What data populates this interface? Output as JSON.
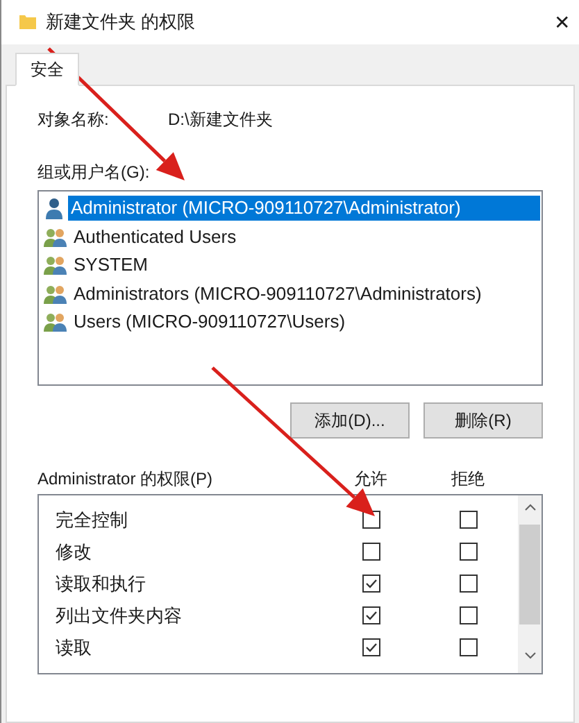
{
  "window": {
    "title": "新建文件夹 的权限",
    "close": "✕"
  },
  "tabs": [
    {
      "label": "安全",
      "selected": true
    }
  ],
  "object_name": {
    "label": "对象名称:",
    "value": "D:\\新建文件夹"
  },
  "users": {
    "label": "组或用户名(G):",
    "items": [
      {
        "name": "Administrator (MICRO-909110727\\Administrator)",
        "kind": "user",
        "selected": true
      },
      {
        "name": "Authenticated Users",
        "kind": "group",
        "selected": false
      },
      {
        "name": "SYSTEM",
        "kind": "group",
        "selected": false
      },
      {
        "name": "Administrators (MICRO-909110727\\Administrators)",
        "kind": "group",
        "selected": false
      },
      {
        "name": "Users (MICRO-909110727\\Users)",
        "kind": "group",
        "selected": false
      }
    ]
  },
  "buttons": [
    "添加(D)...",
    "删除(R)"
  ],
  "permissions": {
    "label": "Administrator 的权限(P)",
    "columns": [
      "允许",
      "拒绝"
    ],
    "rows": [
      {
        "name": "完全控制",
        "allow": false,
        "deny": false
      },
      {
        "name": "修改",
        "allow": false,
        "deny": false
      },
      {
        "name": "读取和执行",
        "allow": true,
        "deny": false
      },
      {
        "name": "列出文件夹内容",
        "allow": true,
        "deny": false
      },
      {
        "name": "读取",
        "allow": true,
        "deny": false
      }
    ]
  },
  "annotations": [
    {
      "kind": "arrow"
    },
    {
      "kind": "arrow"
    }
  ]
}
